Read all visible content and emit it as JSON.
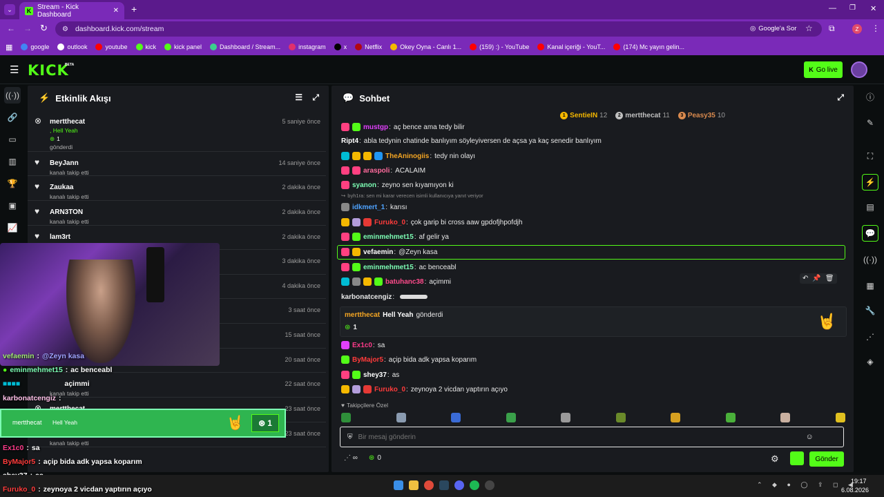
{
  "browser": {
    "tab_title": "Stream - Kick Dashboard",
    "url": "dashboard.kick.com/stream",
    "google_label": "Google'a Sor",
    "profile_initial": "Z",
    "bookmarks": [
      "google",
      "outlook",
      "youtube",
      "kick",
      "kick panel",
      "Dashboard / Stream...",
      "instagram",
      "x",
      "Netflix",
      "Okey Oyna - Canlı 1...",
      "(159) :) - YouTube",
      "Kanal içeriği - YouT...",
      "(174) Mc yayın gelin..."
    ],
    "bookmark_colors": [
      "#4285f4",
      "#ffffff",
      "#ff0000",
      "#53fc18",
      "#53fc18",
      "#3ccf8e",
      "#e1306c",
      "#000000",
      "#b20710",
      "#f5b900",
      "#ff0000",
      "#ff0000",
      "#ff0000"
    ]
  },
  "header": {
    "logo": "KICK",
    "beta": "BETA",
    "go_live": "Go live"
  },
  "activity": {
    "title": "Etkinlik Akışı",
    "items": [
      {
        "name": "mertthecat",
        "line2": ", Hell Yeah",
        "count": "1",
        "line3": "gönderdi",
        "time": "5 saniye önce",
        "icon": "kick-icon"
      },
      {
        "name": "BeyJann",
        "line2": "kanalı takip etti",
        "time": "14 saniye önce",
        "icon": "heart-icon"
      },
      {
        "name": "Zaukaa",
        "line2": "kanalı takip etti",
        "time": "2 dakika önce",
        "icon": "heart-icon"
      },
      {
        "name": "ARN3TON",
        "line2": "kanalı takip etti",
        "time": "2 dakika önce",
        "icon": "heart-icon"
      },
      {
        "name": "lam3rt",
        "line2": "",
        "time": "2 dakika önce",
        "icon": "heart-icon"
      },
      {
        "name": "",
        "line2": "",
        "time": "3 dakika önce",
        "icon": ""
      },
      {
        "name": "",
        "line2": "",
        "time": "4 dakika önce",
        "icon": ""
      },
      {
        "name": "",
        "line2": "",
        "time": "3 saat önce",
        "icon": ""
      },
      {
        "name": "",
        "line2": "",
        "time": "15 saat önce",
        "icon": ""
      },
      {
        "name": "",
        "line2": "",
        "time": "20 saat önce",
        "icon": ""
      },
      {
        "name": "",
        "line2": "kanalı takip etti",
        "time": "22 saat önce",
        "icon": ""
      },
      {
        "name": "mertthecat",
        "line2": ", Hell Yeah",
        "count": "1",
        "line3": "gönderdi",
        "time": "23 saat önce",
        "icon": "kick-icon"
      },
      {
        "name": "egeopi2002",
        "line2": "kanalı takip etti",
        "time": "23 saat önce",
        "icon": "heart-icon"
      }
    ]
  },
  "chat": {
    "title": "Sohbet",
    "leaders": [
      {
        "rank": "1",
        "name": "SentieIN",
        "count": "12",
        "color": "#f5b800"
      },
      {
        "rank": "2",
        "name": "mertthecat",
        "count": "11",
        "color": "#c0c0c0"
      },
      {
        "rank": "3",
        "name": "Peasy35",
        "count": "10",
        "color": "#d98a4e"
      }
    ],
    "messages": [
      {
        "user": "mustgp",
        "text": "aç bence ama tedy bilir",
        "color": "#e040fb",
        "badges": [
          "#ff4081",
          "#53fc18"
        ]
      },
      {
        "user": "Ript4",
        "text": "abla tedynin chatinde banlıyım söyleyiversen de açsa ya kaç senedir banlıyım",
        "color": "#ffffff",
        "badges": []
      },
      {
        "user": "TheAninogiis",
        "text": "tedy nin olayı",
        "color": "#f5a623",
        "badges": [
          "#00bcd4",
          "#f5b800",
          "#f5b800",
          "#2196f3"
        ]
      },
      {
        "user": "araspoli",
        "text": "ACALAIM",
        "color": "#ff6b9d",
        "badges": [
          "#ff4081",
          "#ff4081"
        ]
      },
      {
        "user": "syanon",
        "text": "zeyno sen kıyamıyon ki",
        "color": "#7dffb5",
        "badges": [
          "#ff4081"
        ]
      },
      {
        "user": "idkmert_1",
        "text": "karısı",
        "color": "#4fa3ff",
        "badges": [
          "#888888"
        ],
        "reply": "byh1ra: sen mi karar verecen isimli kullanıcıya yanıt veriyor"
      },
      {
        "user": "Furuko_0",
        "text": "çok garip bi cross aaw gpdofjhpofdjh",
        "color": "#ff3b3b",
        "badges": [
          "#f5b800",
          "#b39ddb",
          "#e53935"
        ]
      },
      {
        "user": "eminmehmet15",
        "text": "af gelir ya",
        "color": "#7dffb5",
        "badges": [
          "#ff4081",
          "#53fc18"
        ]
      },
      {
        "user": "vefaemin",
        "text": "@Zeyn kasa",
        "color": "#ffffff",
        "badges": [
          "#ff4081",
          "#f5b800"
        ]
      },
      {
        "user": "eminmehmet15",
        "text": "ac benceabl",
        "color": "#7dffb5",
        "badges": [
          "#ff4081",
          "#53fc18"
        ]
      },
      {
        "user": "batuhanc38",
        "text": "açimmi",
        "color": "#ff4b8b",
        "badges": [
          "#00bcd4",
          "#888888",
          "#f5b800",
          "#53fc18"
        ]
      },
      {
        "user": "karbonatcengiz",
        "text": "",
        "color": "#e8e8e8",
        "badges": []
      }
    ],
    "gift": {
      "user": "mertthecat",
      "item": "Hell Yeah",
      "verb": "gönderdi",
      "count": "1"
    },
    "messages2": [
      {
        "user": "Ex1c0",
        "text": "sa",
        "color": "#ff3b8a",
        "badges": [
          "#e040fb"
        ]
      },
      {
        "user": "ByMajor5",
        "text": "açip bida adk yapsa koparım",
        "color": "#ff3b3b",
        "badges": [
          "#53fc18"
        ]
      },
      {
        "user": "shey37",
        "text": "as",
        "color": "#ffffff",
        "badges": [
          "#ff4081",
          "#53fc18"
        ]
      },
      {
        "user": "Furuko_0",
        "text": "zeynoya 2 vicdan yaptırın açıyo",
        "color": "#ff3b3b",
        "badges": [
          "#f5b800",
          "#b39ddb",
          "#e53935"
        ]
      }
    ],
    "followers_only": "Takipçilere Özel",
    "input_placeholder": "Bir mesaj gönderin",
    "kicks_count": "0",
    "send_label": "Gönder"
  },
  "overlay": {
    "vef_user": "vefaemin",
    "vef_text": "@Zeyn kasa",
    "emin_user": "eminmehmet15",
    "emin_text": "ac benceabl",
    "batu_text": "açimmi",
    "karbon_user": "karbonatcengiz",
    "alert_user": "mertthecat",
    "alert_item": "Hell Yeah",
    "alert_count": "1",
    "ex_user": "Ex1c0",
    "ex_text": "sa",
    "by_user": "ByMajor5",
    "by_text": "açip bida adk yapsa koparım",
    "shey_user": "shey37",
    "shey_text": "as",
    "furu_user": "Furuko_0",
    "furu_text": "zeynoya 2 vicdan yaptırın açıyo"
  },
  "taskbar": {
    "time": "19:17",
    "date": "6.08.2026"
  }
}
